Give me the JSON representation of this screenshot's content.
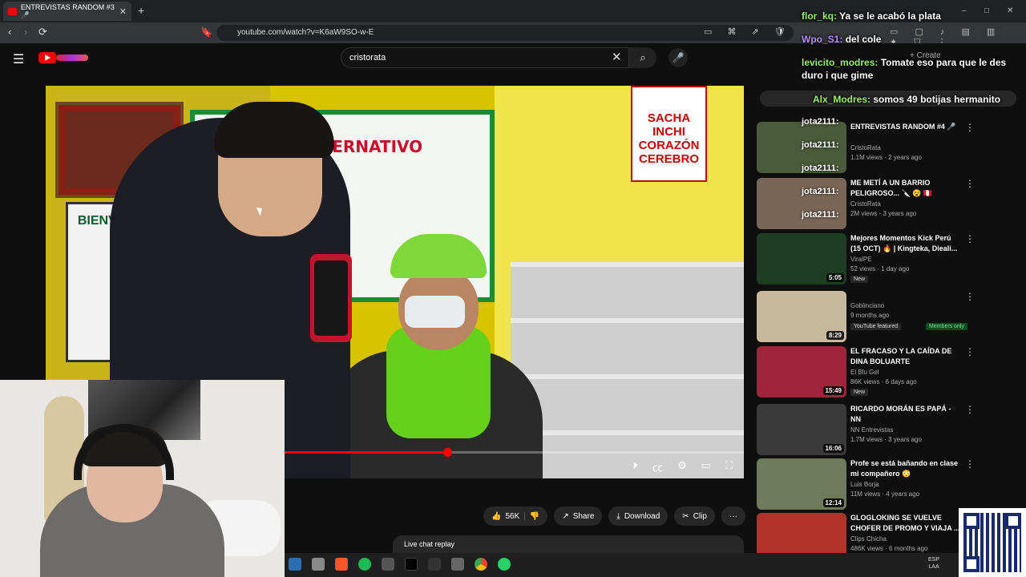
{
  "browser": {
    "tab_title": "ENTREVISTAS RANDOM #3 🎤",
    "new_tab": "+",
    "url": "youtube.com/watch?v=K6aW9SO-w-E",
    "nav_back": "‹",
    "nav_forward": "›",
    "reload": "⟳",
    "tab_close": "✕",
    "window_controls": [
      "–",
      "□",
      "✕"
    ]
  },
  "youtube": {
    "search_value": "cristorata",
    "create_label": "+ Create",
    "video": {
      "sign_banner": "CO ALTERNATIVO",
      "sign_welcome": "BIENVENIDOS",
      "sign_shelf": "SACHA INCHI CORAZÓN CEREBRO",
      "progress": 0.575
    },
    "actions": {
      "like_count": "56K",
      "share": "Share",
      "download": "Download",
      "clip": "Clip",
      "more": "···"
    },
    "live_chat_replay": "Live chat replay",
    "recommendations": [
      {
        "title": "ENTREVISTAS RANDOM #4 🎤",
        "channel": "CristoRata",
        "meta": "1.1M views · 2 years ago",
        "duration": "",
        "badges": [],
        "thumb": "#4a5b3a"
      },
      {
        "title": "ME METÍ A UN BARRIO PELIGROSO... 🔪 😵 🇵🇪",
        "channel": "CristoRata",
        "meta": "2M views · 3 years ago",
        "duration": "",
        "badges": [],
        "thumb": "#7a6656"
      },
      {
        "title": "Mejores Momentos Kick Perú (15 OCT) 🔥 | Kingteka, Dieali...",
        "channel": "ViralPE",
        "meta": "52 views · 1 day ago",
        "duration": "5:05",
        "badges": [
          "New"
        ],
        "thumb": "#1f3d22"
      },
      {
        "title": "",
        "channel": "Goblinciano",
        "meta": "9 months ago",
        "duration": "8:29",
        "badges": [
          "YouTube featured",
          "Members only"
        ],
        "thumb": "#c9b99c"
      },
      {
        "title": "EL FRACASO Y LA CAÍDA DE DINA BOLUARTE",
        "channel": "El Blu Gel",
        "meta": "86K views · 6 days ago",
        "duration": "15:49",
        "badges": [
          "New"
        ],
        "thumb": "#a1253a"
      },
      {
        "title": "RICARDO MORÁN ES PAPÁ - NN",
        "channel": "NN Entrevistas",
        "meta": "1.7M views · 3 years ago",
        "duration": "16:06",
        "badges": [],
        "thumb": "#3a3a3a"
      },
      {
        "title": "Profe se está bañando en clase mi compañero 😳",
        "channel": "Luis Borja",
        "meta": "11M views · 4 years ago",
        "duration": "12:14",
        "badges": [],
        "thumb": "#6f7a5a"
      },
      {
        "title": "GLOGLOKING SE VUELVE CHOFER DE PROMO Y VIAJA ...",
        "channel": "Clips Chicha",
        "meta": "486K views · 6 months ago",
        "duration": "",
        "badges": [],
        "thumb": "#b0332a"
      }
    ]
  },
  "chat": [
    {
      "user": "flor_kq:",
      "text": "Ya se le acabó la plata",
      "color": "#9ef06a"
    },
    {
      "user": "Wpo_S1:",
      "text": "del cole",
      "color": "#b78cff"
    },
    {
      "user": "levicito_modres:",
      "text": "Tomate eso para que le des duro i que gime",
      "color": "#9ef06a"
    },
    {
      "user": "Alx_Modres:",
      "text": "somos 49 botijas hermanito",
      "color": "#9ef06a"
    }
  ],
  "chat_jota": [
    "jota2111:",
    "jota2111:",
    "jota2111:",
    "jota2111:",
    "jota2111:"
  ],
  "taskbar": {
    "lang": "ESP",
    "layout": "LAA"
  },
  "colors": {
    "accent": "#ff0000",
    "bg": "#0f0f0f",
    "chat_user": "#9ef06a"
  }
}
